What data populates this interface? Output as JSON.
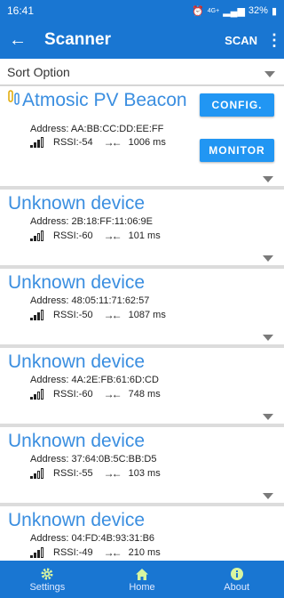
{
  "status_bar": {
    "time": "16:41",
    "battery": "32%",
    "network": "4G+"
  },
  "app_bar": {
    "title": "Scanner",
    "scan_label": "SCAN",
    "back_icon": "arrow-left-icon",
    "more_icon": "more-vert-icon"
  },
  "sort": {
    "label": "Sort Option"
  },
  "devices": [
    {
      "name": "Atmosic PV Beacon",
      "address": "Address: AA:BB:CC:DD:EE:FF",
      "rssi": "RSSI:-54",
      "interval": "1006 ms",
      "signal_bars": 3,
      "config_label": "CONFIG.",
      "monitor_label": "MONITOR"
    },
    {
      "name": "Unknown device",
      "address": "Address: 2B:18:FF:11:06:9E",
      "rssi": "RSSI:-60",
      "interval": "101 ms",
      "signal_bars": 2
    },
    {
      "name": "Unknown device",
      "address": "Address: 48:05:11:71:62:57",
      "rssi": "RSSI:-50",
      "interval": "1087 ms",
      "signal_bars": 3
    },
    {
      "name": "Unknown device",
      "address": "Address: 4A:2E:FB:61:6D:CD",
      "rssi": "RSSI:-60",
      "interval": "748 ms",
      "signal_bars": 2
    },
    {
      "name": "Unknown device",
      "address": "Address: 37:64:0B:5C:BB:D5",
      "rssi": "RSSI:-55",
      "interval": "103 ms",
      "signal_bars": 2
    },
    {
      "name": "Unknown device",
      "address": "Address: 04:FD:4B:93:31:B6",
      "rssi": "RSSI:-49",
      "interval": "210 ms",
      "signal_bars": 3
    }
  ],
  "bottom_nav": {
    "settings_label": "Settings",
    "home_label": "Home",
    "about_label": "About"
  },
  "colors": {
    "primary": "#1976d2",
    "accent_button": "#2196f3",
    "device_name": "#3a8ee0"
  }
}
